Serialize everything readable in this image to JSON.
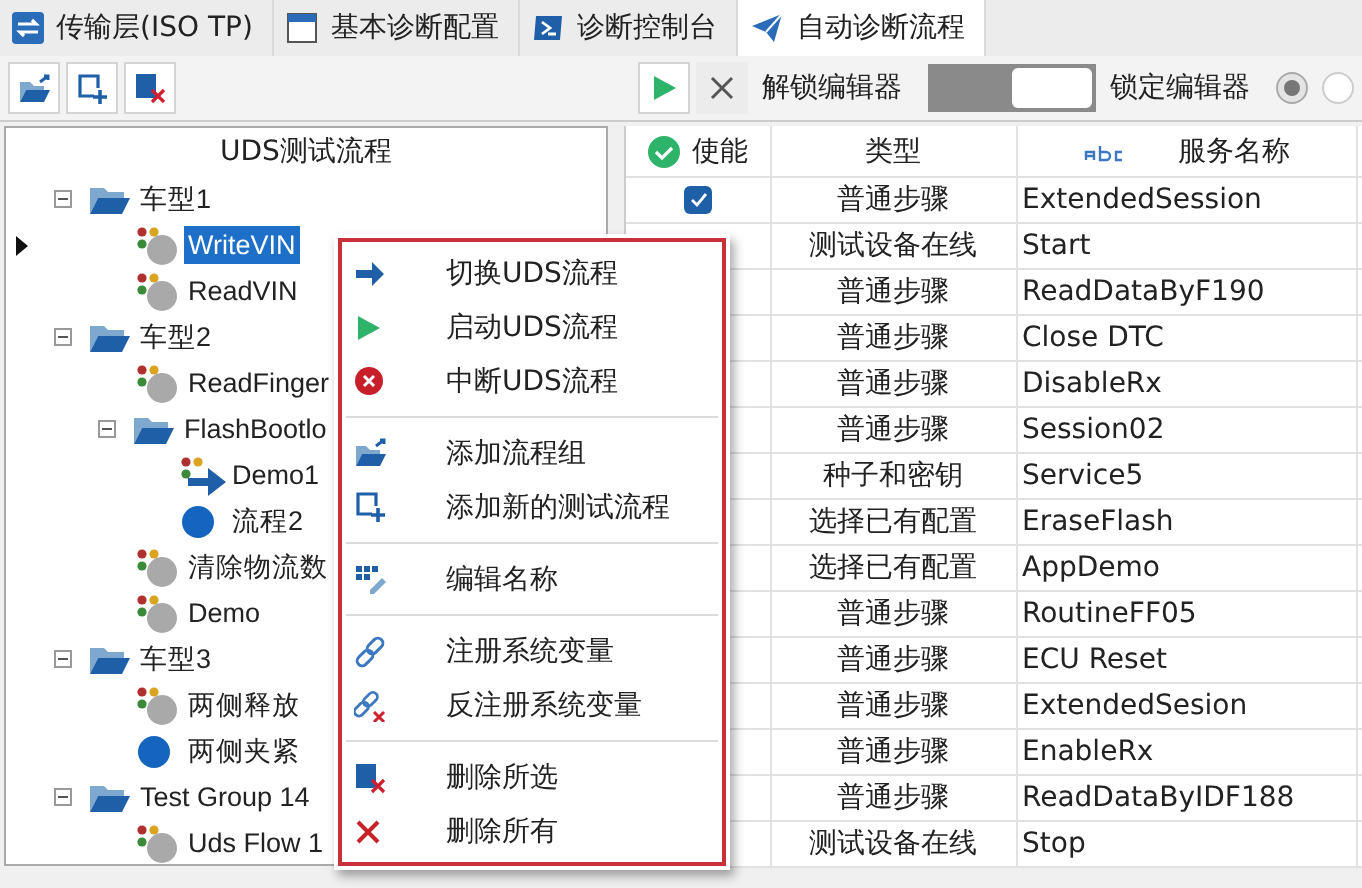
{
  "tabs": [
    {
      "label": "传输层(ISO TP)",
      "selected": false
    },
    {
      "label": "基本诊断配置",
      "selected": false
    },
    {
      "label": "诊断控制台",
      "selected": false
    },
    {
      "label": "自动诊断流程",
      "selected": true
    }
  ],
  "toolbar": {
    "unlock_label": "解锁编辑器",
    "toggle": {
      "on": true
    },
    "lock_label": "锁定编辑器",
    "radios": [
      {
        "selected": true
      },
      {
        "selected": false
      }
    ]
  },
  "tree": {
    "title": "UDS测试流程",
    "items": [
      {
        "label": "车型1",
        "kind": "group",
        "expanded": true,
        "selected": false,
        "children": [
          {
            "label": "WriteVIN",
            "kind": "flow",
            "selected": true
          },
          {
            "label": "ReadVIN",
            "kind": "flow",
            "selected": false
          }
        ]
      },
      {
        "label": "车型2",
        "kind": "group",
        "expanded": true,
        "selected": false,
        "children": [
          {
            "label": "ReadFinger",
            "kind": "flow",
            "selected": false
          },
          {
            "label": "FlashBootlo",
            "kind": "group",
            "expanded": true,
            "selected": false,
            "children": [
              {
                "label": "Demo1",
                "kind": "current",
                "selected": false
              },
              {
                "label": "流程2",
                "kind": "dot",
                "selected": false
              }
            ]
          },
          {
            "label": "清除物流数",
            "kind": "flow",
            "selected": false
          },
          {
            "label": "Demo",
            "kind": "flow",
            "selected": false
          }
        ]
      },
      {
        "label": "车型3",
        "kind": "group",
        "expanded": true,
        "selected": false,
        "children": [
          {
            "label": "两侧释放",
            "kind": "flow",
            "selected": false
          },
          {
            "label": "两侧夹紧",
            "kind": "dot",
            "selected": false
          }
        ]
      },
      {
        "label": "Test Group 14",
        "kind": "group",
        "expanded": true,
        "selected": false,
        "children": [
          {
            "label": "Uds Flow 1",
            "kind": "flow",
            "selected": false
          }
        ]
      }
    ]
  },
  "context_menu": {
    "sections": [
      [
        "切换UDS流程",
        "启动UDS流程",
        "中断UDS流程"
      ],
      [
        "添加流程组",
        "添加新的测试流程"
      ],
      [
        "编辑名称"
      ],
      [
        "注册系统变量",
        "反注册系统变量"
      ],
      [
        "删除所选",
        "删除所有"
      ]
    ]
  },
  "table": {
    "columns": [
      "使能",
      "类型",
      "服务名称"
    ],
    "rows": [
      {
        "checked": true,
        "type": "普通步骤",
        "service": "ExtendedSession"
      },
      {
        "type": "测试设备在线",
        "service": "Start"
      },
      {
        "type": "普通步骤",
        "service": "ReadDataByF190"
      },
      {
        "type": "普通步骤",
        "service": "Close DTC"
      },
      {
        "type": "普通步骤",
        "service": "DisableRx"
      },
      {
        "type": "普通步骤",
        "service": "Session02"
      },
      {
        "type": "种子和密钥",
        "service": "Service5"
      },
      {
        "type": "选择已有配置",
        "service": "EraseFlash"
      },
      {
        "type": "选择已有配置",
        "service": "AppDemo"
      },
      {
        "type": "普通步骤",
        "service": "RoutineFF05"
      },
      {
        "type": "普通步骤",
        "service": "ECU Reset"
      },
      {
        "type": "普通步骤",
        "service": "ExtendedSesion"
      },
      {
        "type": "普通步骤",
        "service": "EnableRx"
      },
      {
        "type": "普通步骤",
        "service": "ReadDataByIDF188"
      },
      {
        "type": "测试设备在线",
        "service": "Stop"
      }
    ]
  }
}
